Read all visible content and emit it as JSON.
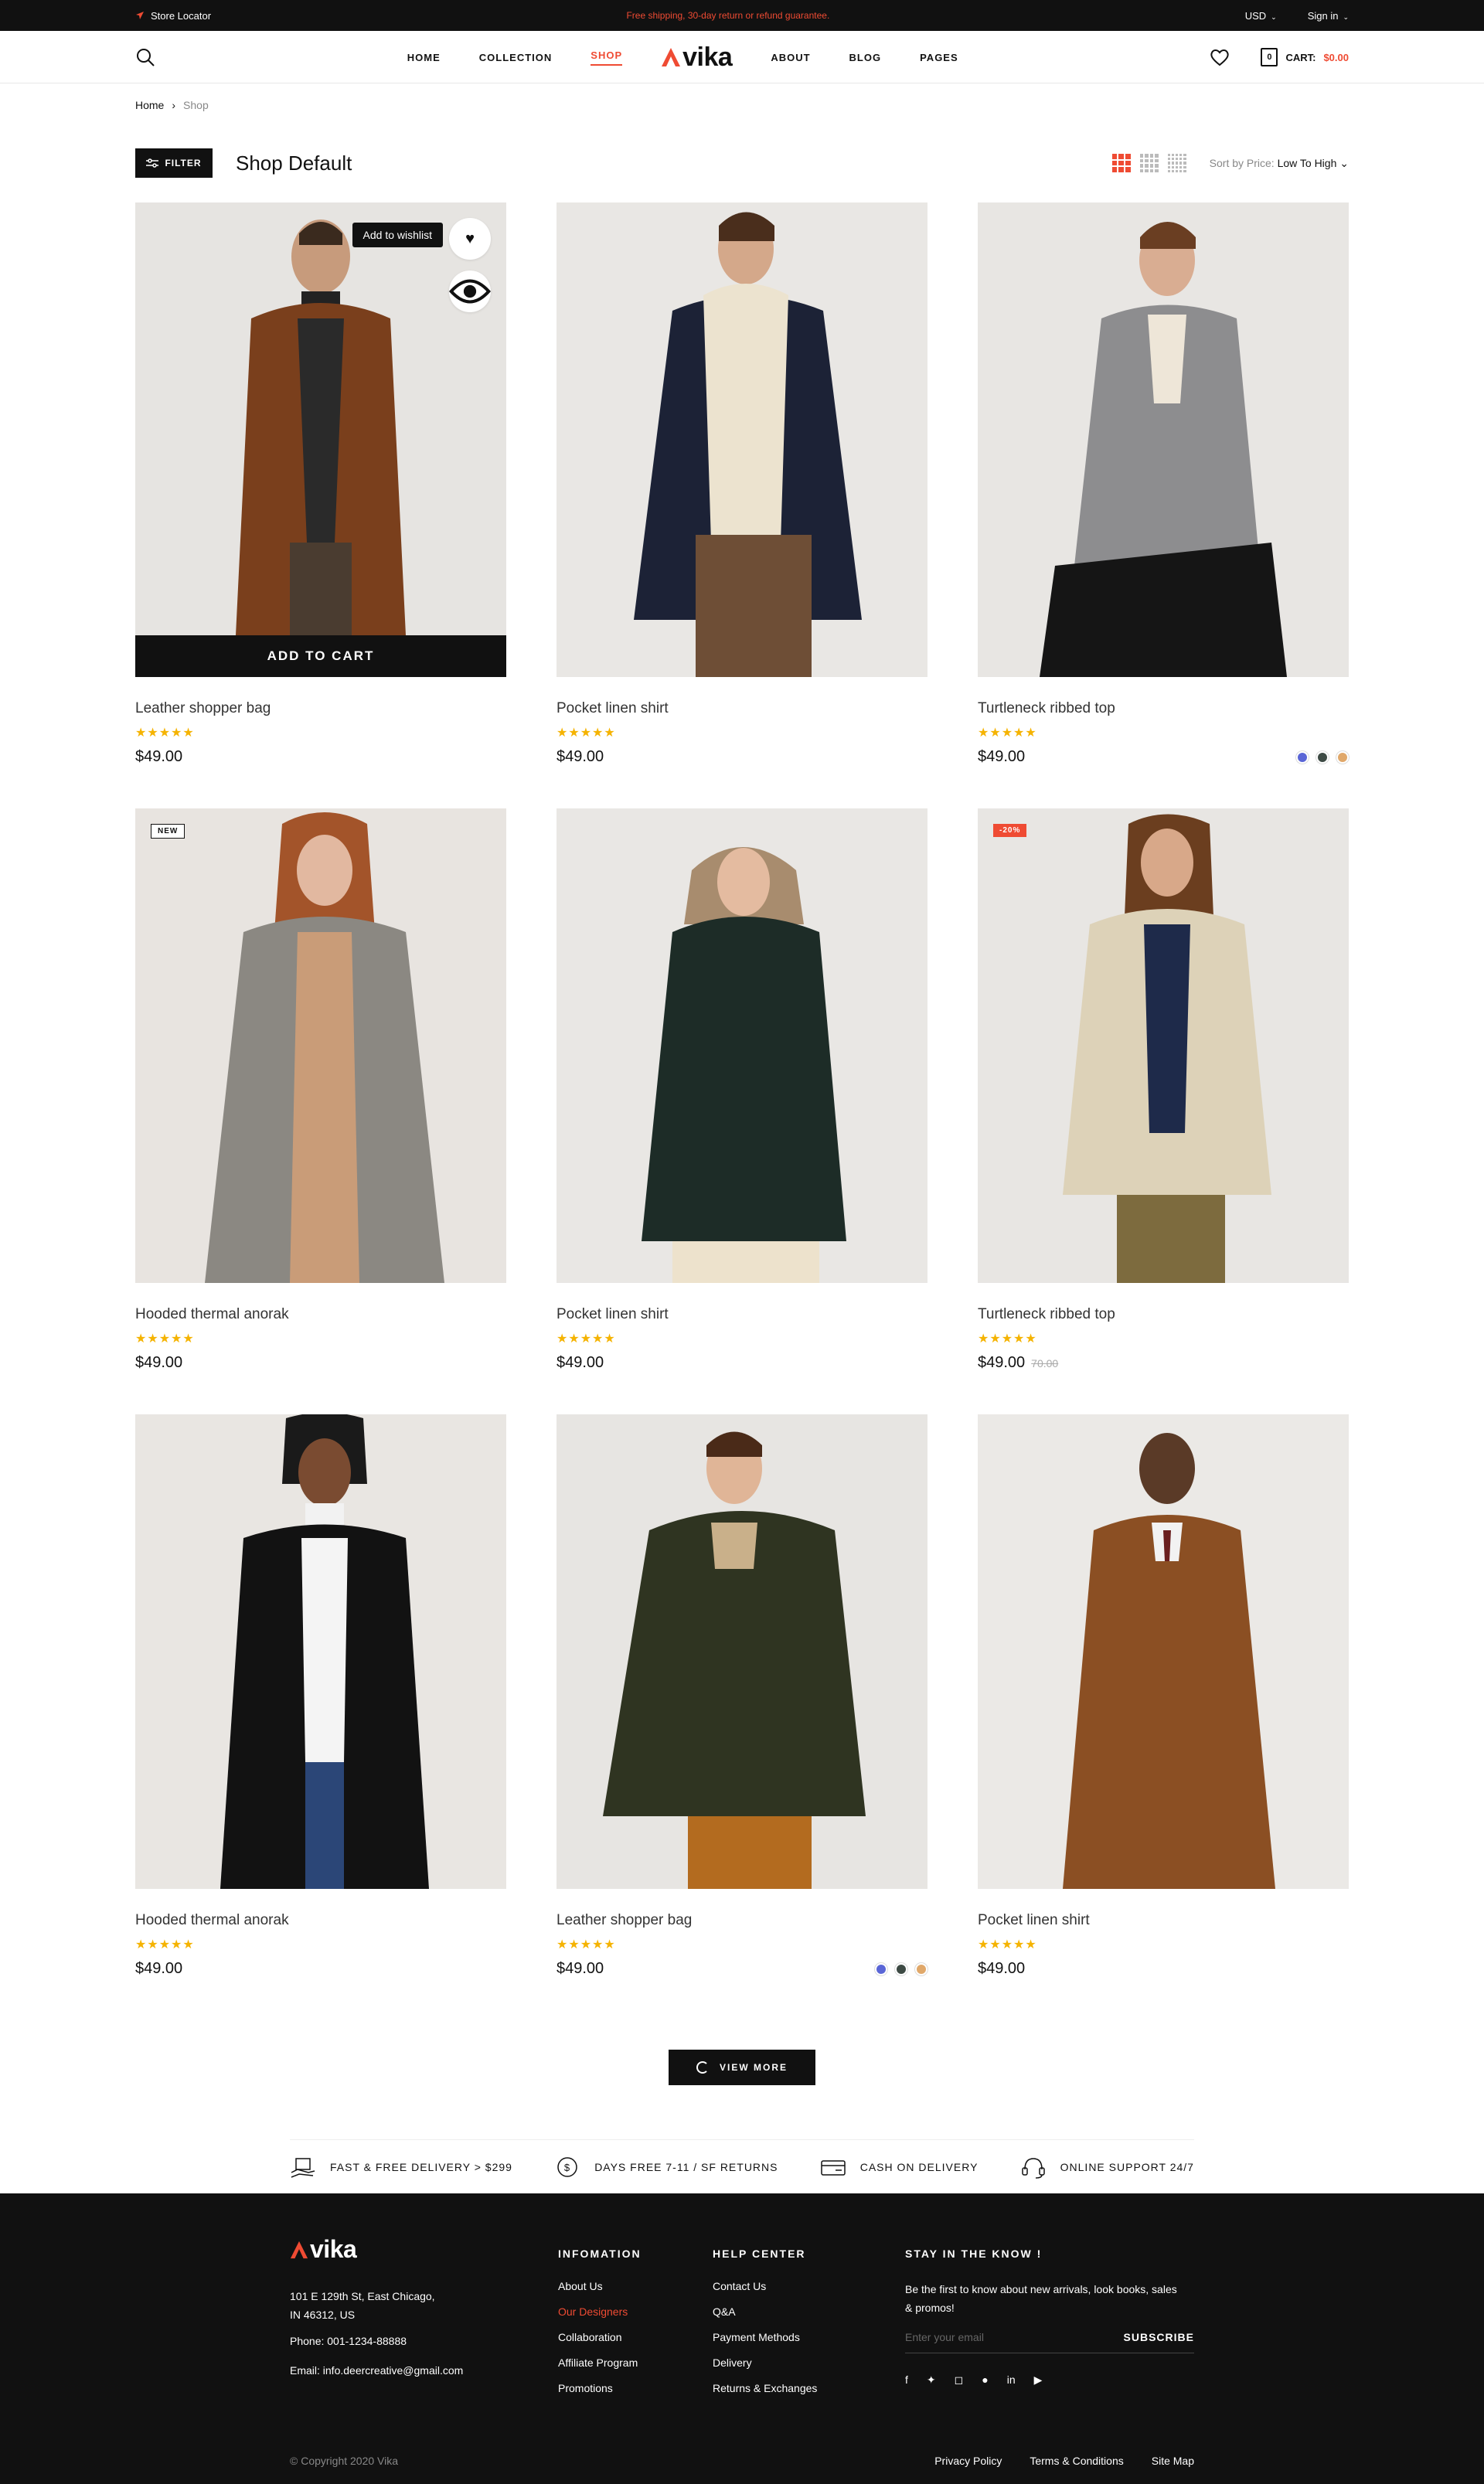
{
  "topbar": {
    "store_locator": "Store Locator",
    "promo": "Free shipping, 30-day return or refund guarantee.",
    "currency": "USD",
    "sign_in": "Sign in"
  },
  "header": {
    "nav_left": [
      "HOME",
      "COLLECTION",
      "SHOP"
    ],
    "nav_right": [
      "ABOUT",
      "BLOG",
      "PAGES"
    ],
    "logo": "vika",
    "cart_count": "0",
    "cart_label": "CART:",
    "cart_total": "$0.00"
  },
  "breadcrumb": {
    "home": "Home",
    "current": "Shop"
  },
  "toolbar": {
    "filter": "FILTER",
    "title": "Shop Default",
    "sort_label": "Sort by Price:",
    "sort_value": "Low To High"
  },
  "products": [
    {
      "name": "Leather shopper bag",
      "price": "$49.00",
      "old_price": "",
      "badge": "",
      "stars": "★★★★★",
      "tooltip": "Add to wishlist",
      "add_to_cart": "ADD TO CART"
    },
    {
      "name": "Pocket linen shirt",
      "price": "$49.00",
      "old_price": "",
      "badge": "",
      "stars": "★★★★★"
    },
    {
      "name": "Turtleneck ribbed top",
      "price": "$49.00",
      "old_price": "",
      "badge": "",
      "stars": "★★★★★"
    },
    {
      "name": "Hooded thermal anorak",
      "price": "$49.00",
      "old_price": "",
      "badge": "NEW",
      "stars": "★★★★★"
    },
    {
      "name": "Pocket linen shirt",
      "price": "$49.00",
      "old_price": "",
      "badge": "",
      "stars": "★★★★★"
    },
    {
      "name": "Turtleneck ribbed top",
      "price": "$49.00",
      "old_price": "70.00",
      "badge": "-20%",
      "stars": "★★★★★"
    },
    {
      "name": "Hooded thermal anorak",
      "price": "$49.00",
      "old_price": "",
      "badge": "",
      "stars": "★★★★★"
    },
    {
      "name": "Leather shopper bag",
      "price": "$49.00",
      "old_price": "",
      "badge": "",
      "stars": "★★★★★"
    },
    {
      "name": "Pocket linen shirt",
      "price": "$49.00",
      "old_price": "",
      "badge": "",
      "stars": "★★★★★"
    }
  ],
  "swatch_colors": [
    "#5a66d6",
    "#3d4a44",
    "#e0a86a"
  ],
  "view_more": "VIEW MORE",
  "features": [
    {
      "icon": "delivery-icon",
      "label": "FAST & FREE DELIVERY > $299"
    },
    {
      "icon": "returns-icon",
      "label": "DAYS FREE 7-11 / SF RETURNS"
    },
    {
      "icon": "cash-icon",
      "label": "CASH ON DELIVERY"
    },
    {
      "icon": "support-icon",
      "label": "ONLINE SUPPORT 24/7"
    }
  ],
  "footer": {
    "logo": "vika",
    "address_line1": "101 E 129th St, East Chicago,",
    "address_line2": "IN 46312, US",
    "phone": "Phone: 001-1234-88888",
    "email": "Email: info.deercreative@gmail.com",
    "info_title": "INFOMATION",
    "info_links": [
      "About Us",
      "Our Designers",
      "Collaboration",
      "Affiliate Program",
      "Promotions"
    ],
    "help_title": "HELP CENTER",
    "help_links": [
      "Contact Us",
      "Q&A",
      "Payment Methods",
      "Delivery",
      "Returns & Exchanges"
    ],
    "news_title": "STAY IN THE KNOW !",
    "news_text": "Be the first to know about new arrivals, look books, sales & promos!",
    "email_placeholder": "Enter your email",
    "subscribe": "SUBSCRIBE",
    "copyright": "© Copyright 2020 Vika",
    "bottom_links": [
      "Privacy Policy",
      "Terms & Conditions",
      "Site Map"
    ]
  },
  "colors": {
    "accent": "#ef4b33",
    "dark": "#111111",
    "star": "#f5b301"
  }
}
